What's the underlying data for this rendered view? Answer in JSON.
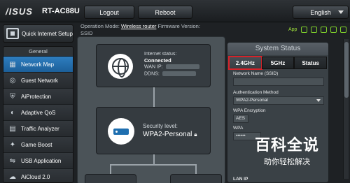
{
  "header": {
    "logo": "/ISUS",
    "model": "RT-AC88U",
    "logout_label": "Logout",
    "reboot_label": "Reboot",
    "language_label": "English"
  },
  "status_line": {
    "operation_mode_label": "Operation Mode:",
    "operation_mode_value": "Wireless router",
    "firmware_label": "Firmware Version:",
    "ssid_label": "SSID",
    "app_label": "App"
  },
  "sidebar": {
    "qis_label": "Quick Internet Setup",
    "section_header": "General",
    "items": [
      {
        "label": "Network Map",
        "icon": "network-map-icon",
        "active": true
      },
      {
        "label": "Guest Network",
        "icon": "guest-network-icon"
      },
      {
        "label": "AiProtection",
        "icon": "aiprotection-icon"
      },
      {
        "label": "Adaptive QoS",
        "icon": "qos-icon"
      },
      {
        "label": "Traffic Analyzer",
        "icon": "traffic-analyzer-icon"
      },
      {
        "label": "Game Boost",
        "icon": "game-boost-icon"
      },
      {
        "label": "USB Application",
        "icon": "usb-icon"
      },
      {
        "label": "AiCloud 2.0",
        "icon": "cloud-icon"
      }
    ]
  },
  "network_map": {
    "internet_status_label": "Internet status:",
    "internet_status_value": "Connected",
    "wan_ip_label": "WAN IP:",
    "ddns_label": "DDNS:",
    "security_label": "Security level:",
    "security_value": "WPA2-Personal"
  },
  "system_status": {
    "title": "System Status",
    "tabs": [
      "2.4GHz",
      "5GHz",
      "Status"
    ],
    "active_tab": "2.4GHz",
    "network_name_label": "Network Name (SSID)",
    "auth_method_label": "Authentication Method",
    "auth_method_value": "WPA2-Personal",
    "wpa_encryption_label": "WPA Encryption",
    "wpa_encryption_value": "AES",
    "wpa_key_label": "WPA",
    "wpa_key_value": "••••••",
    "lan_ip_label": "LAN IP"
  },
  "watermark": {
    "title": "百科全说",
    "subtitle": "助你轻松解决"
  },
  "colors": {
    "accent_blue": "#1c5f99",
    "highlight_red": "#d5232a",
    "status_green": "#7fd12b"
  }
}
